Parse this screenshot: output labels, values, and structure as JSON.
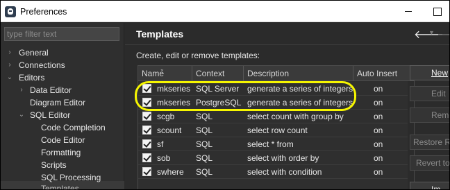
{
  "window": {
    "title": "Preferences",
    "min_icon": "minimize-icon",
    "max_icon": "maximize-icon"
  },
  "left": {
    "filter_placeholder": "type filter text",
    "tree": [
      {
        "label": "General",
        "twisty": "›"
      },
      {
        "label": "Connections",
        "twisty": "›"
      },
      {
        "label": "Editors",
        "twisty": "⌄"
      },
      {
        "label": "Data Editor",
        "twisty": "›"
      },
      {
        "label": "Diagram Editor",
        "twisty": ""
      },
      {
        "label": "SQL Editor",
        "twisty": "⌄"
      },
      {
        "label": "Code Completion",
        "twisty": ""
      },
      {
        "label": "Code Editor",
        "twisty": ""
      },
      {
        "label": "Formatting",
        "twisty": ""
      },
      {
        "label": "Scripts",
        "twisty": ""
      },
      {
        "label": "SQL Processing",
        "twisty": ""
      },
      {
        "label": "Templates",
        "twisty": ""
      }
    ]
  },
  "right": {
    "title": "Templates",
    "description": "Create, edit or remove templates:",
    "nav_back": "🡐",
    "nav_dropdown": "▼",
    "nav_forward": "🡒",
    "columns": [
      "Name",
      "Context",
      "Description",
      "Auto Insert"
    ],
    "rows": [
      {
        "enabled": true,
        "name": "mkseries",
        "context": "SQL Server",
        "description": "generate a series of integers",
        "auto_insert": "on"
      },
      {
        "enabled": true,
        "name": "mkseries",
        "context": "PostgreSQL",
        "description": "generate a series of integers",
        "auto_insert": "on"
      },
      {
        "enabled": true,
        "name": "scgb",
        "context": "SQL",
        "description": "select count with group by",
        "auto_insert": "on"
      },
      {
        "enabled": true,
        "name": "scount",
        "context": "SQL",
        "description": "select row count",
        "auto_insert": "on"
      },
      {
        "enabled": true,
        "name": "sf",
        "context": "SQL",
        "description": "select * from",
        "auto_insert": "on"
      },
      {
        "enabled": true,
        "name": "sob",
        "context": "SQL",
        "description": "select with order by",
        "auto_insert": "on"
      },
      {
        "enabled": true,
        "name": "swhere",
        "context": "SQL",
        "description": "select with condition",
        "auto_insert": "on"
      }
    ],
    "buttons": [
      {
        "label": "New",
        "disabled": false
      },
      {
        "label": "Edit",
        "disabled": true
      },
      {
        "label": "Remo",
        "disabled": true
      },
      {
        "label": "Restore Re",
        "disabled": true
      },
      {
        "label": "Revert to",
        "disabled": true
      },
      {
        "label": "Im",
        "disabled": false
      }
    ]
  },
  "highlight_color": "#f5f500"
}
